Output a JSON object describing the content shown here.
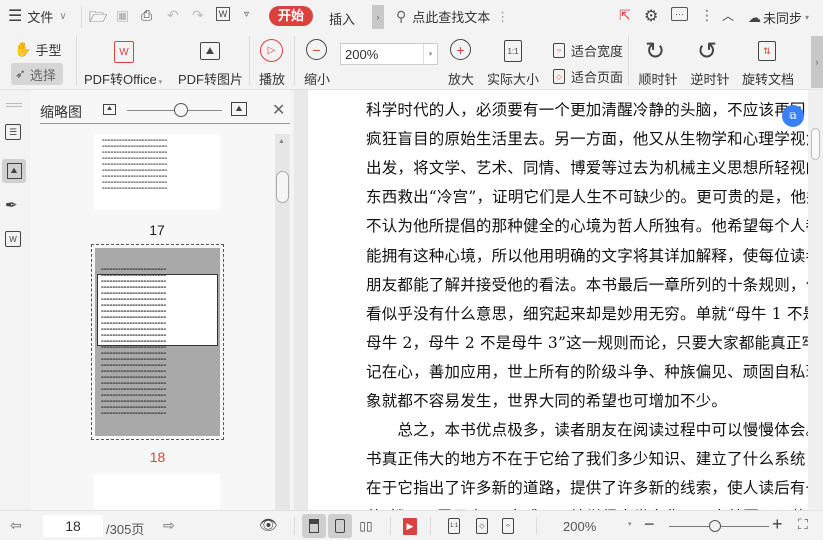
{
  "titlebar": {
    "file_menu": "文件",
    "start_tab": "开始",
    "insert_tab": "插入",
    "search_placeholder": "点此查找文本",
    "sync_status": "未同步"
  },
  "ribbon": {
    "hand_tool": "手型",
    "select_tool": "选择",
    "pdf_to_office": "PDF转Office",
    "pdf_to_image": "PDF转图片",
    "play": "播放",
    "zoom_out": "缩小",
    "zoom_value": "200%",
    "zoom_in": "放大",
    "actual_size": "实际大小",
    "fit_width": "适合宽度",
    "fit_page": "适合页面",
    "rotate_cw": "顺时针",
    "rotate_ccw": "逆时针",
    "rotate_doc": "旋转文档",
    "actual_size_icon_text": "1:1"
  },
  "thumbnails": {
    "title": "缩略图",
    "pages": [
      {
        "label": "17"
      },
      {
        "label": "18",
        "current": true
      }
    ]
  },
  "document": {
    "lines": [
      "科学时代的人，必须要有一个更加清醒冷静的头脑，不应该再回",
      "疯狂盲目的原始生活里去。另一方面，他又从生物学和心理学视角",
      "出发，将文学、艺术、同情、博爱等过去为机械主义思想所轻视的",
      "东西救出“冷宫”，证明它们是人生不可缺少的。更可贵的是，他并",
      "不认为他所提倡的那种健全的心境为哲人所独有。他希望每个人都",
      "能拥有这种心境，所以他用明确的文字将其详加解释，使每位读者",
      "朋友都能了解并接受他的看法。本书最后一章所列的十条规则，乍",
      "看似乎没有什么意思，细究起来却是妙用无穷。单就“母牛 1 不是",
      "母牛 2，母牛 2 不是母牛 3”这一规则而论，只要大家都能真正牢",
      "记在心，善加应用，世上所有的阶级斗争、种族偏见、顽固自私现",
      "象就都不容易发生，世界大同的希望也可增加不少。",
      "　　总之，本书优点极多，读者朋友在阅读过程中可以慢慢体会。本",
      "书真正伟大的地方不在于它给了我们多少知识、建立了什么系统，而",
      "在于它指出了许多新的道路，提供了许多新的线索，使人读后有一",
      "种“拨开云雾见青天”之感，开始觉得人类文化不一定就要远远落"
    ]
  },
  "statusbar": {
    "current_page": "18",
    "total_pages": "/305页",
    "zoom": "200%",
    "fit_icon_text": "1:1"
  },
  "colors": {
    "accent_red": "#d9423f",
    "float_blue": "#3b7ff5"
  }
}
